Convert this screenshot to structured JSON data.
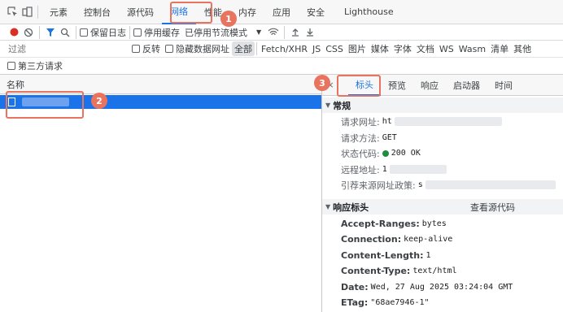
{
  "devtools": {
    "tabs": [
      "元素",
      "控制台",
      "源代码",
      "网络",
      "性能",
      "内存",
      "应用",
      "安全",
      "Lighthouse"
    ],
    "active_tab": "网络"
  },
  "toolbar": {
    "preserve_log": "保留日志",
    "disable_cache": "停用缓存",
    "throttle": "已停用节流模式"
  },
  "filter": {
    "placeholder": "过滤",
    "invert": "反转",
    "hide_data_urls": "隐藏数据网址",
    "types": [
      "全部",
      "Fetch/XHR",
      "JS",
      "CSS",
      "图片",
      "媒体",
      "字体",
      "文档",
      "WS",
      "Wasm",
      "清单",
      "其他"
    ],
    "active_type": "全部",
    "third_party": "第三方请求"
  },
  "request_list": {
    "name_header": "名称"
  },
  "details": {
    "tabs": [
      "标头",
      "预览",
      "响应",
      "启动器",
      "时间"
    ],
    "active_tab": "标头",
    "general": {
      "title": "常规",
      "request_url_label": "请求网址:",
      "request_url_value": "ht",
      "method_label": "请求方法:",
      "method_value": "GET",
      "status_label": "状态代码:",
      "status_value": "200 OK",
      "status_color": "#1e8e3e",
      "remote_label": "远程地址:",
      "remote_value": "1",
      "referrer_label": "引荐来源网址政策:",
      "referrer_value": "s"
    },
    "response_headers": {
      "title": "响应标头",
      "view_source": "查看源代码",
      "items": [
        {
          "name": "Accept-Ranges:",
          "value": "bytes"
        },
        {
          "name": "Connection:",
          "value": "keep-alive"
        },
        {
          "name": "Content-Length:",
          "value": "1"
        },
        {
          "name": "Content-Type:",
          "value": "text/html"
        },
        {
          "name": "Date:",
          "value": "Wed, 27 Aug 2025 03:24:04 GMT"
        },
        {
          "name": "ETag:",
          "value": "\"68ae7946-1\""
        }
      ]
    }
  },
  "annotations": {
    "badge_1": "1",
    "badge_2": "2",
    "badge_3": "3",
    "color": "#e8735e"
  },
  "accent_color": "#1a73e8"
}
